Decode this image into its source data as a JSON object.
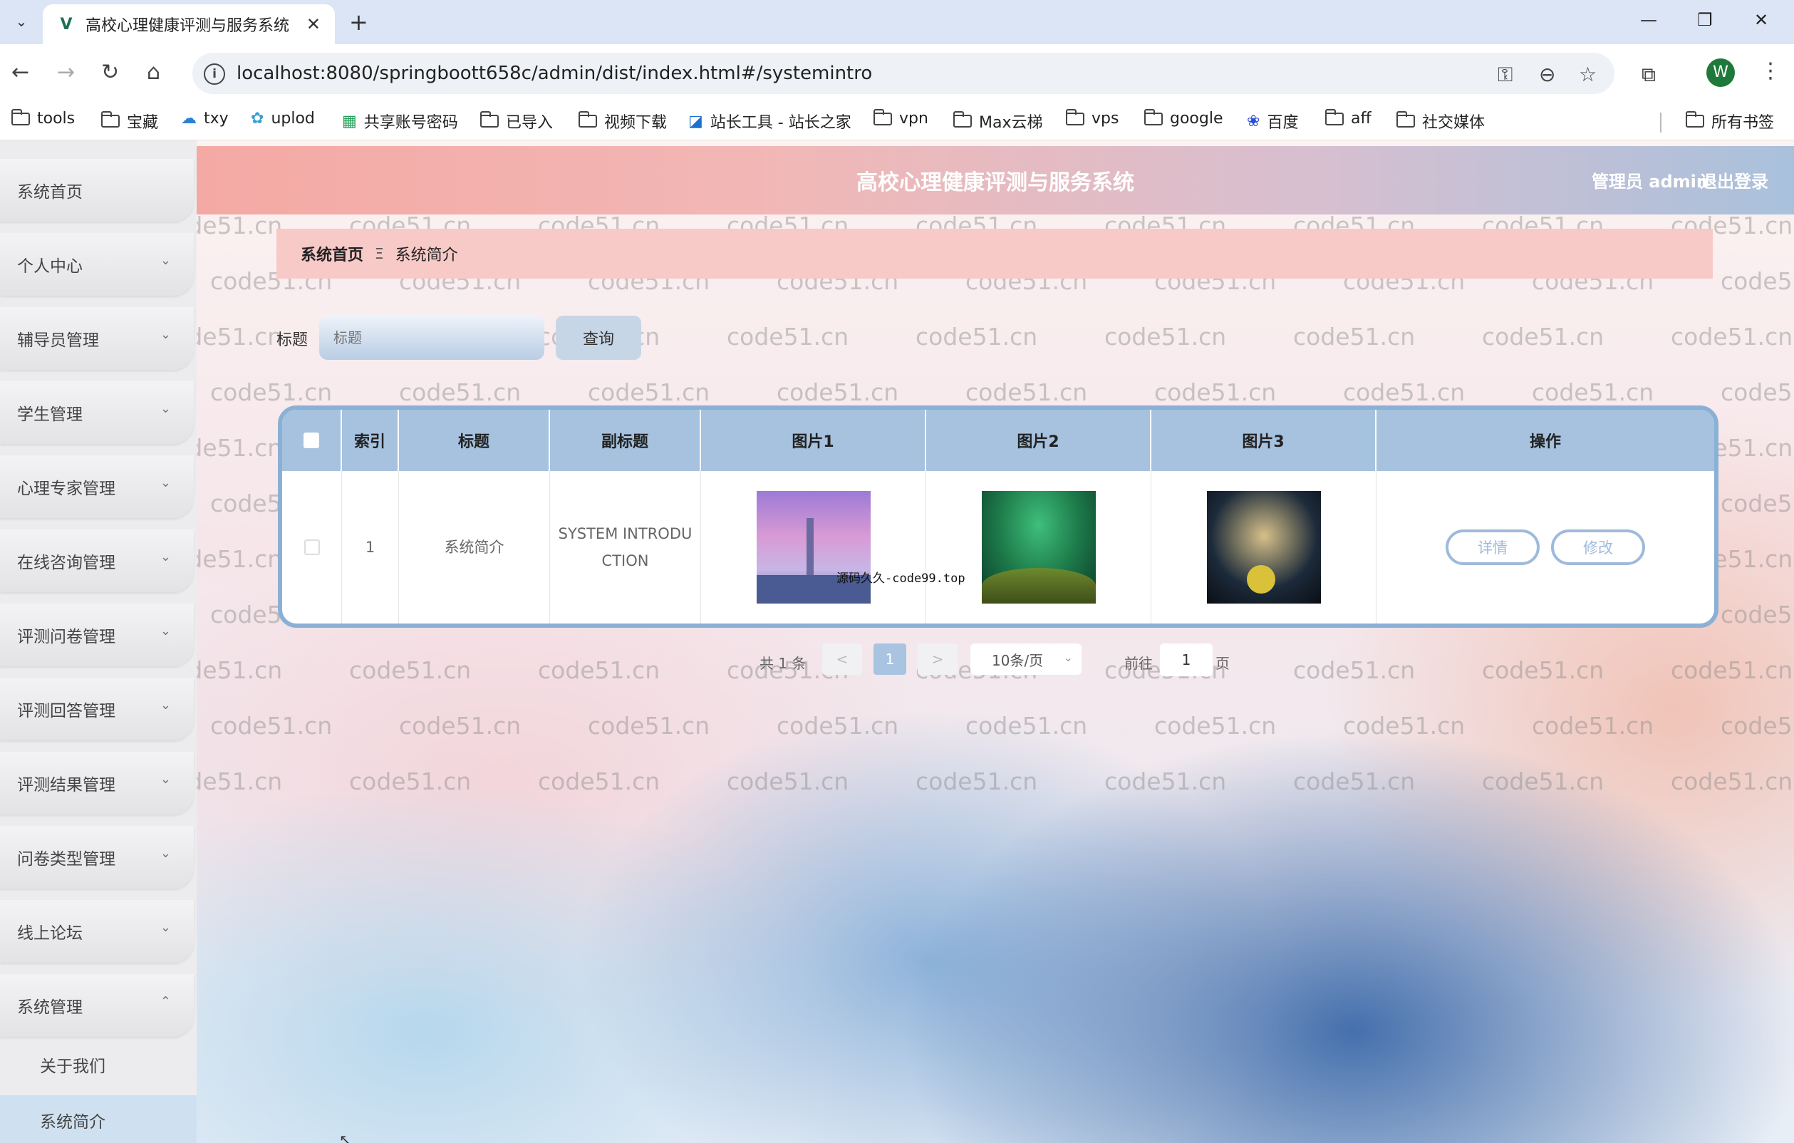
{
  "browser": {
    "tab_title": "高校心理健康评测与服务系统",
    "url": "localhost:8080/springboott658c/admin/dist/index.html#/systemintro",
    "profile_initial": "W",
    "bookmarks": [
      "tools",
      "宝藏",
      "txy",
      "uplod",
      "共享账号密码",
      "已导入",
      "视频下载",
      "站长工具 - 站长之家",
      "vpn",
      "Max云梯",
      "vps",
      "google",
      "百度",
      "aff",
      "社交媒体"
    ],
    "all_bookmarks": "所有书签"
  },
  "header": {
    "title": "高校心理健康评测与服务系统",
    "user": "管理员 admin",
    "logout": "退出登录"
  },
  "sidebar": {
    "items": [
      {
        "label": "系统首页"
      },
      {
        "label": "个人中心"
      },
      {
        "label": "辅导员管理"
      },
      {
        "label": "学生管理"
      },
      {
        "label": "心理专家管理"
      },
      {
        "label": "在线咨询管理"
      },
      {
        "label": "评测问卷管理"
      },
      {
        "label": "评测回答管理"
      },
      {
        "label": "评测结果管理"
      },
      {
        "label": "问卷类型管理"
      },
      {
        "label": "线上论坛"
      },
      {
        "label": "系统管理"
      }
    ],
    "sub_items": [
      {
        "label": "关于我们"
      },
      {
        "label": "系统简介"
      }
    ]
  },
  "breadcrumb": {
    "home": "系统首页",
    "separator": "Ξ",
    "current": "系统简介"
  },
  "search": {
    "label": "标题",
    "placeholder": "标题",
    "button": "查询"
  },
  "table": {
    "headers": [
      "索引",
      "标题",
      "副标题",
      "图片1",
      "图片2",
      "图片3",
      "操作"
    ],
    "rows": [
      {
        "index": "1",
        "title": "系统简介",
        "subtitle_line1": "SYSTEM INTRODU",
        "subtitle_line2": "CTION",
        "detail": "详情",
        "edit": "修改"
      }
    ],
    "image_overlay_text": "源码久久-code99.top"
  },
  "pagination": {
    "total": "共 1 条",
    "prev": "<",
    "current": "1",
    "next": ">",
    "page_size": "10条/页",
    "goto": "前往",
    "goto_value": "1",
    "unit": "页"
  },
  "watermark": "code51.cn",
  "colors": {
    "header_start": "#f4a9a4",
    "header_end": "#a9c1dc",
    "table_header": "#a6c2df",
    "breadcrumb_bg": "#f7c9c7",
    "accent": "#9fbadb"
  }
}
